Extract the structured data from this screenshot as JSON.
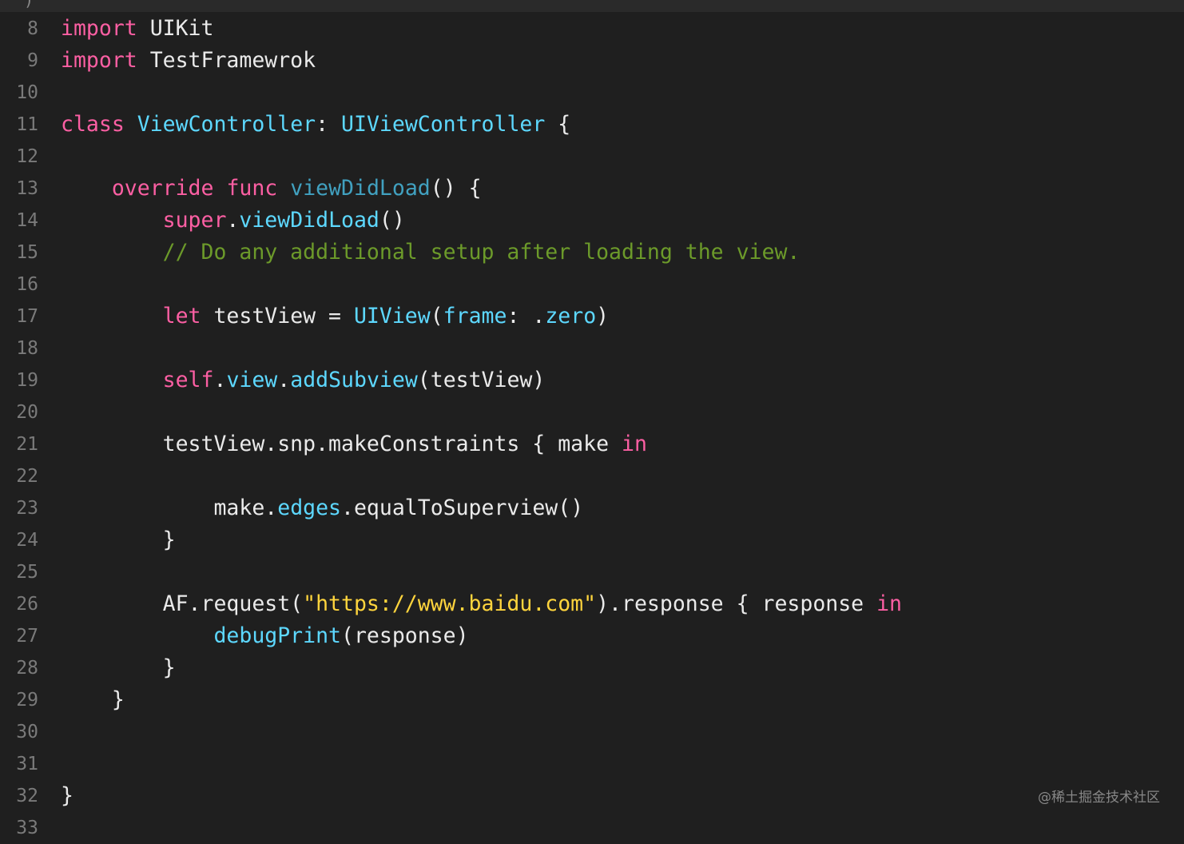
{
  "colors": {
    "background": "#1f1f1f",
    "keyword": "#fc5fa3",
    "type": "#5dd8ff",
    "declaration": "#41a1c0",
    "comment": "#6c9a2a",
    "string": "#ffd53d",
    "plain": "#eaeaea",
    "line_number": "#7a7a7a"
  },
  "top_strip": {
    "prev_line_tail": ")"
  },
  "lines": [
    {
      "number": "8",
      "tokens": [
        {
          "t": "import",
          "c": "kw"
        },
        {
          "t": " UIKit",
          "c": "plain"
        }
      ]
    },
    {
      "number": "9",
      "tokens": [
        {
          "t": "import",
          "c": "kw"
        },
        {
          "t": " TestFramewrok",
          "c": "plain"
        }
      ]
    },
    {
      "number": "10",
      "tokens": []
    },
    {
      "number": "11",
      "tokens": [
        {
          "t": "class",
          "c": "kw"
        },
        {
          "t": " ",
          "c": "plain"
        },
        {
          "t": "ViewController",
          "c": "type"
        },
        {
          "t": ": ",
          "c": "plain"
        },
        {
          "t": "UIViewController",
          "c": "type"
        },
        {
          "t": " {",
          "c": "plain"
        }
      ]
    },
    {
      "number": "12",
      "tokens": []
    },
    {
      "number": "13",
      "tokens": [
        {
          "t": "    ",
          "c": "plain"
        },
        {
          "t": "override",
          "c": "kw"
        },
        {
          "t": " ",
          "c": "plain"
        },
        {
          "t": "func",
          "c": "kw"
        },
        {
          "t": " ",
          "c": "plain"
        },
        {
          "t": "viewDidLoad",
          "c": "decl"
        },
        {
          "t": "() {",
          "c": "plain"
        }
      ]
    },
    {
      "number": "14",
      "tokens": [
        {
          "t": "        ",
          "c": "plain"
        },
        {
          "t": "super",
          "c": "kw"
        },
        {
          "t": ".",
          "c": "plain"
        },
        {
          "t": "viewDidLoad",
          "c": "type"
        },
        {
          "t": "()",
          "c": "plain"
        }
      ]
    },
    {
      "number": "15",
      "tokens": [
        {
          "t": "        ",
          "c": "plain"
        },
        {
          "t": "// Do any additional setup after loading the view.",
          "c": "comment"
        }
      ]
    },
    {
      "number": "16",
      "tokens": []
    },
    {
      "number": "17",
      "tokens": [
        {
          "t": "        ",
          "c": "plain"
        },
        {
          "t": "let",
          "c": "kw"
        },
        {
          "t": " testView = ",
          "c": "plain"
        },
        {
          "t": "UIView",
          "c": "type"
        },
        {
          "t": "(",
          "c": "plain"
        },
        {
          "t": "frame",
          "c": "type"
        },
        {
          "t": ": .",
          "c": "plain"
        },
        {
          "t": "zero",
          "c": "type"
        },
        {
          "t": ")",
          "c": "plain"
        }
      ]
    },
    {
      "number": "18",
      "tokens": []
    },
    {
      "number": "19",
      "tokens": [
        {
          "t": "        ",
          "c": "plain"
        },
        {
          "t": "self",
          "c": "kw"
        },
        {
          "t": ".",
          "c": "plain"
        },
        {
          "t": "view",
          "c": "type"
        },
        {
          "t": ".",
          "c": "plain"
        },
        {
          "t": "addSubview",
          "c": "type"
        },
        {
          "t": "(testView)",
          "c": "plain"
        }
      ]
    },
    {
      "number": "20",
      "tokens": []
    },
    {
      "number": "21",
      "tokens": [
        {
          "t": "        testView.snp.makeConstraints { make ",
          "c": "plain"
        },
        {
          "t": "in",
          "c": "kw"
        }
      ]
    },
    {
      "number": "22",
      "tokens": []
    },
    {
      "number": "23",
      "tokens": [
        {
          "t": "            make.",
          "c": "plain"
        },
        {
          "t": "edges",
          "c": "type"
        },
        {
          "t": ".equalToSuperview()",
          "c": "plain"
        }
      ]
    },
    {
      "number": "24",
      "tokens": [
        {
          "t": "        }",
          "c": "plain"
        }
      ]
    },
    {
      "number": "25",
      "tokens": []
    },
    {
      "number": "26",
      "tokens": [
        {
          "t": "        AF.request(",
          "c": "plain"
        },
        {
          "t": "\"https://www.baidu.com\"",
          "c": "string"
        },
        {
          "t": ").response { response ",
          "c": "plain"
        },
        {
          "t": "in",
          "c": "kw"
        }
      ]
    },
    {
      "number": "27",
      "tokens": [
        {
          "t": "            ",
          "c": "plain"
        },
        {
          "t": "debugPrint",
          "c": "type"
        },
        {
          "t": "(response)",
          "c": "plain"
        }
      ]
    },
    {
      "number": "28",
      "tokens": [
        {
          "t": "        }",
          "c": "plain"
        }
      ]
    },
    {
      "number": "29",
      "tokens": [
        {
          "t": "    }",
          "c": "plain"
        }
      ]
    },
    {
      "number": "30",
      "tokens": []
    },
    {
      "number": "31",
      "tokens": []
    },
    {
      "number": "32",
      "tokens": [
        {
          "t": "}",
          "c": "plain"
        }
      ]
    },
    {
      "number": "33",
      "tokens": []
    }
  ],
  "watermark": "@稀土掘金技术社区"
}
